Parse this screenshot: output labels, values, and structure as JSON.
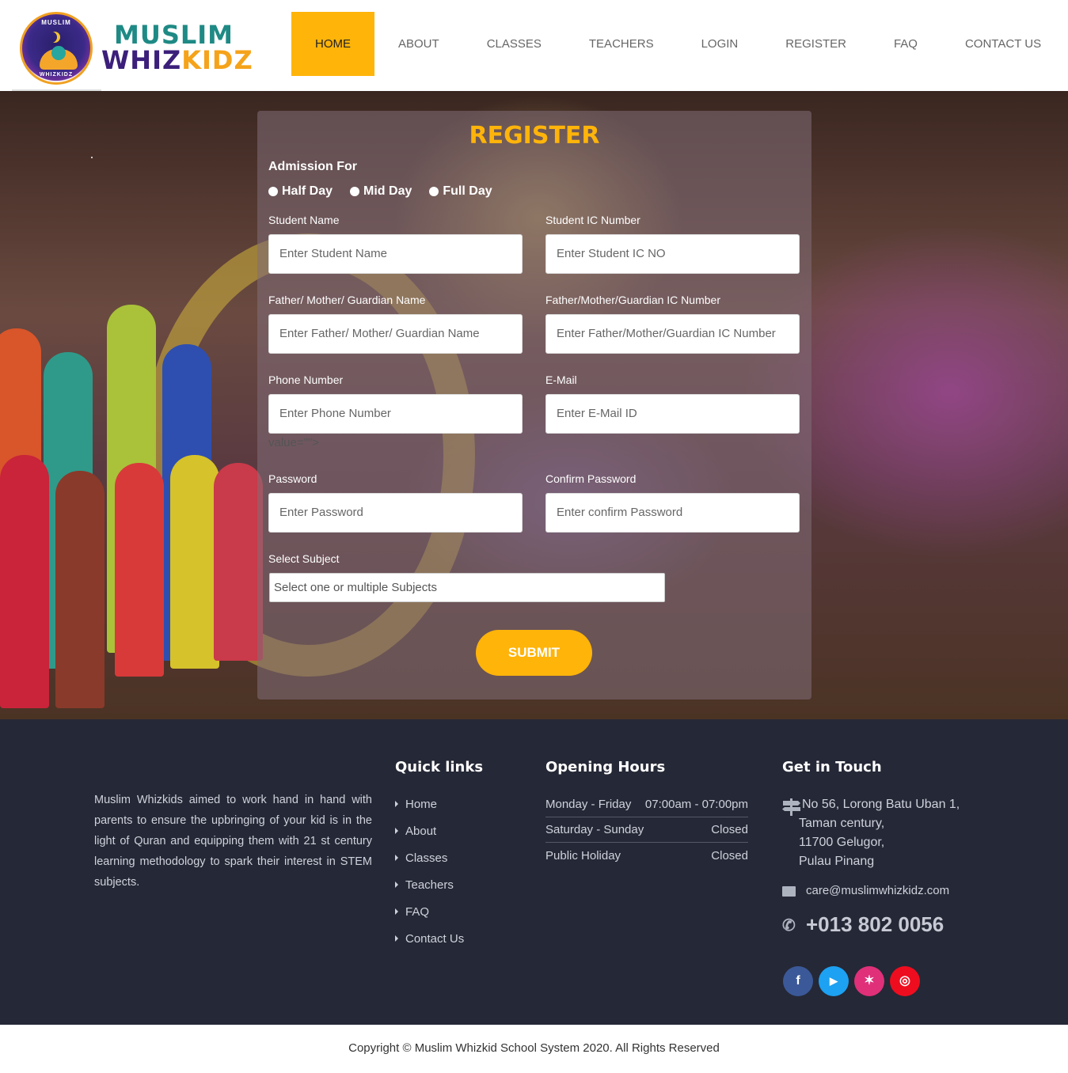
{
  "brand": {
    "top": "MUSLIM",
    "bottom_a": "WHIZ",
    "bottom_b": "KIDZ",
    "badge_top": "MUSLIM",
    "badge_bottom": "WHIZKIDZ"
  },
  "nav": [
    "HOME",
    "ABOUT",
    "CLASSES",
    "TEACHERS",
    "LOGIN",
    "REGISTER",
    "FAQ",
    "CONTACT US"
  ],
  "form": {
    "title": "REGISTER",
    "admission_label": "Admission For",
    "admission_options": [
      "Half Day",
      "Mid Day",
      "Full Day"
    ],
    "fields": {
      "student_name": {
        "label": "Student Name",
        "placeholder": "Enter Student Name"
      },
      "student_ic": {
        "label": "Student IC Number",
        "placeholder": "Enter Student IC NO"
      },
      "guardian_name": {
        "label": "Father/ Mother/ Guardian Name",
        "placeholder": "Enter Father/ Mother/ Guardian Name"
      },
      "guardian_ic": {
        "label": "Father/Mother/Guardian IC Number",
        "placeholder": "Enter Father/Mother/Guardian IC Number"
      },
      "phone": {
        "label": "Phone Number",
        "placeholder": "Enter Phone Number"
      },
      "email": {
        "label": "E-Mail",
        "placeholder": "Enter E-Mail ID"
      },
      "password": {
        "label": "Password",
        "placeholder": "Enter Password"
      },
      "confirm_password": {
        "label": "Confirm Password",
        "placeholder": "Enter confirm Password"
      }
    },
    "stray_text": "value=\"\">",
    "subject_label": "Select Subject",
    "subject_placeholder": "Select one or multiple Subjects",
    "submit_label": "SUBMIT"
  },
  "footer": {
    "about": "Muslim Whizkids aimed to work hand in hand with parents to ensure the upbringing of your kid is in the light of Quran and equipping them with 21 st century learning methodology to spark their interest in STEM subjects.",
    "quick_links_title": "Quick links",
    "quick_links": [
      "Home",
      "About",
      "Classes",
      "Teachers",
      "FAQ",
      "Contact Us"
    ],
    "hours_title": "Opening Hours",
    "hours": [
      {
        "day": "Monday - Friday",
        "time": "07:00am - 07:00pm"
      },
      {
        "day": "Saturday - Sunday",
        "time": "Closed"
      },
      {
        "day": "Public Holiday",
        "time": "Closed"
      }
    ],
    "contact_title": "Get in Touch",
    "address": [
      "No 56, Lorong Batu Uban 1,",
      "Taman century,",
      "11700 Gelugor,",
      "Pulau Pinang"
    ],
    "email": "care@muslimwhizkidz.com",
    "phone": "+013 802 0056",
    "socials": [
      {
        "name": "facebook",
        "glyph": "f",
        "color": "#3b5998"
      },
      {
        "name": "youtube",
        "glyph": "▶",
        "color": "#1da1f2"
      },
      {
        "name": "twitter",
        "glyph": "✶",
        "color": "#e0307a"
      },
      {
        "name": "instagram",
        "glyph": "◎",
        "color": "#ee0d1f"
      }
    ]
  },
  "copyright": "Copyright © Muslim Whizkid School System 2020. All Rights Reserved",
  "colors": {
    "accent": "#ffb40a",
    "footer_bg": "#252836"
  }
}
